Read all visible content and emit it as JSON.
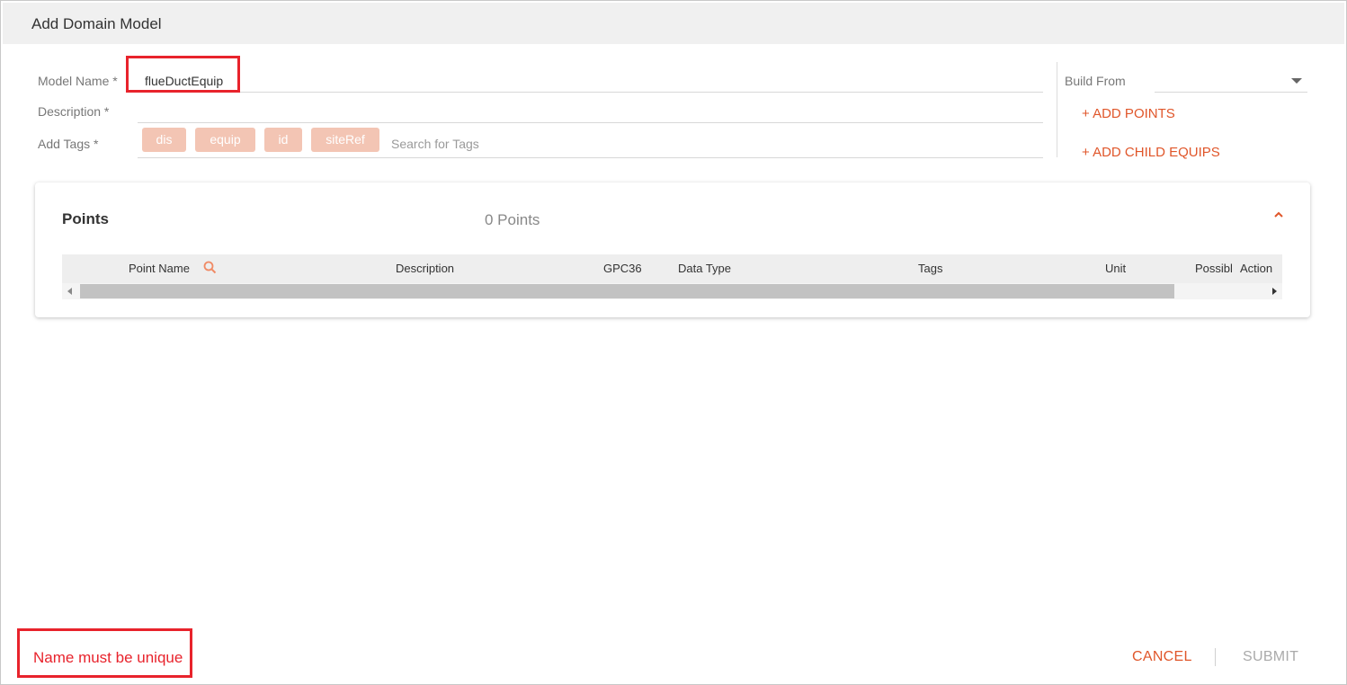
{
  "dialog": {
    "title": "Add Domain Model"
  },
  "form": {
    "model_name_label": "Model Name *",
    "model_name_value": "flueDuctEquip",
    "description_label": "Description *",
    "description_value": "",
    "tags_label": "Add Tags *",
    "tags": [
      "dis",
      "equip",
      "id",
      "siteRef"
    ],
    "tag_search_placeholder": "Search for Tags"
  },
  "side": {
    "build_from_label": "Build From",
    "build_from_value": "",
    "add_points": "+ ADD POINTS",
    "add_child_equips": "+ ADD CHILD EQUIPS"
  },
  "points": {
    "title": "Points",
    "count": "0 Points",
    "columns": [
      "Point Name",
      "Description",
      "GPC36",
      "Data Type",
      "Tags",
      "Unit",
      "Possibl",
      "Action"
    ]
  },
  "footer": {
    "error": "Name must be unique",
    "cancel": "CANCEL",
    "submit": "SUBMIT"
  },
  "colors": {
    "accent": "#e0562a",
    "tag_chip": "#f3c5b4",
    "error": "#e8232c",
    "disabled": "#aaaaaa"
  }
}
